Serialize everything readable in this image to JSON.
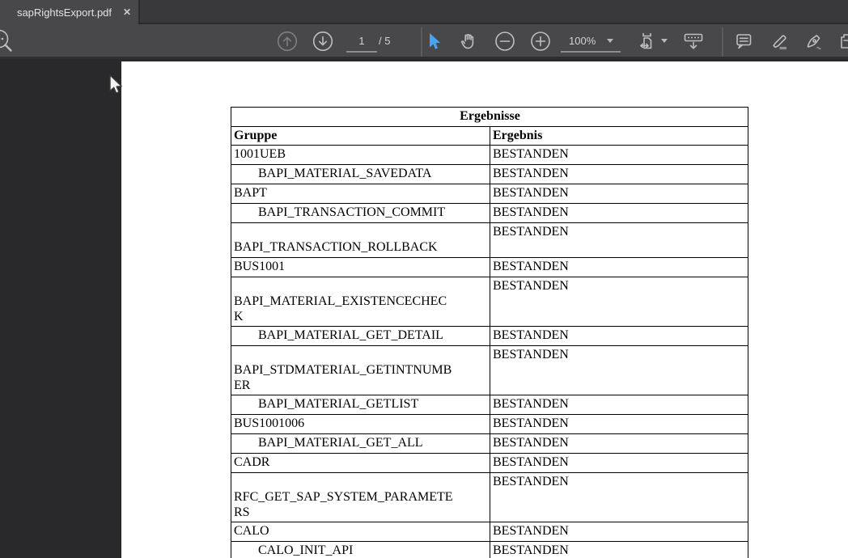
{
  "window": {
    "tab_title": "sapRightsExport.pdf",
    "tab_close_glyph": "✕"
  },
  "toolbar": {
    "page_current": "1",
    "page_total": "/ 5",
    "zoom_level": "100%",
    "icons": [
      "search-icon",
      "page-up-icon",
      "page-down-icon",
      "select-tool-icon",
      "hand-tool-icon",
      "zoom-out-icon",
      "zoom-in-icon",
      "fit-width-icon",
      "toolbar-collapse-icon",
      "comment-icon",
      "highlighter-icon",
      "pen-icon"
    ],
    "colors": {
      "active_tool": "#4aa3f0",
      "icon": "#bcbec0",
      "toolbar_bg": "#48484a",
      "tabbar_bg": "#39393b",
      "viewer_bg": "#29292b"
    }
  },
  "document": {
    "table": {
      "title": "Ergebnisse",
      "columns": [
        "Gruppe",
        "Ergebnis"
      ],
      "rows": [
        {
          "group": "1001UEB",
          "result": "BESTANDEN",
          "indent": false
        },
        {
          "group": "BAPI_MATERIAL_SAVEDATA",
          "result": "BESTANDEN",
          "indent": true
        },
        {
          "group": "BAPT",
          "result": "BESTANDEN",
          "indent": false
        },
        {
          "group": "BAPI_TRANSACTION_COMMIT",
          "result": "BESTANDEN",
          "indent": true
        },
        {
          "group": "BAPI_TRANSACTION_ROLLBACK",
          "result": "BESTANDEN",
          "indent": false,
          "wrap_lines": [
            "",
            "BAPI_TRANSACTION_ROLLBACK"
          ]
        },
        {
          "group": "BUS1001",
          "result": "BESTANDEN",
          "indent": false
        },
        {
          "group": "BAPI_MATERIAL_EXISTENCECHECK",
          "result": "BESTANDEN",
          "indent": false,
          "wrap_lines": [
            "",
            "BAPI_MATERIAL_EXISTENCECHEC",
            "K"
          ]
        },
        {
          "group": "BAPI_MATERIAL_GET_DETAIL",
          "result": "BESTANDEN",
          "indent": true
        },
        {
          "group": "BAPI_STDMATERIAL_GETINTNUMBER",
          "result": "BESTANDEN",
          "indent": false,
          "wrap_lines": [
            "",
            "BAPI_STDMATERIAL_GETINTNUMB",
            "ER"
          ]
        },
        {
          "group": "BAPI_MATERIAL_GETLIST",
          "result": "BESTANDEN",
          "indent": true
        },
        {
          "group": "BUS1001006",
          "result": "BESTANDEN",
          "indent": false
        },
        {
          "group": "BAPI_MATERIAL_GET_ALL",
          "result": "BESTANDEN",
          "indent": true
        },
        {
          "group": "CADR",
          "result": "BESTANDEN",
          "indent": false
        },
        {
          "group": "RFC_GET_SAP_SYSTEM_PARAMETERS",
          "result": "BESTANDEN",
          "indent": false,
          "wrap_lines": [
            "",
            "RFC_GET_SAP_SYSTEM_PARAMETE",
            "RS"
          ]
        },
        {
          "group": "CALO",
          "result": "BESTANDEN",
          "indent": false
        },
        {
          "group": "CALO_INIT_API",
          "result": "BESTANDEN",
          "indent": true
        }
      ]
    }
  }
}
